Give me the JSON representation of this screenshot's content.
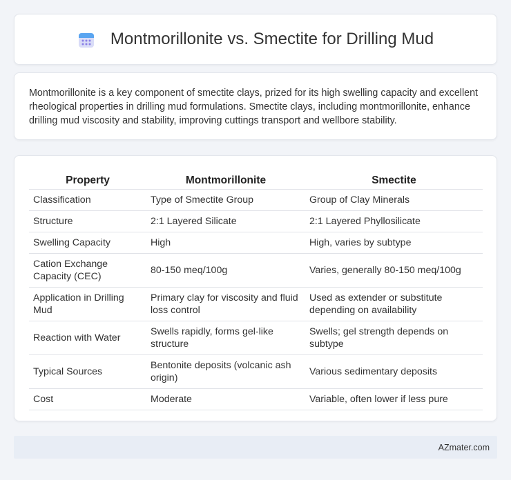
{
  "header": {
    "icon": "calendar-icon",
    "title": "Montmorillonite vs. Smectite for Drilling Mud"
  },
  "description": "Montmorillonite is a key component of smectite clays, prized for its high swelling capacity and excellent rheological properties in drilling mud formulations. Smectite clays, including montmorillonite, enhance drilling mud viscosity and stability, improving cuttings transport and wellbore stability.",
  "table": {
    "headers": [
      "Property",
      "Montmorillonite",
      "Smectite"
    ],
    "rows": [
      [
        "Classification",
        "Type of Smectite Group",
        "Group of Clay Minerals"
      ],
      [
        "Structure",
        "2:1 Layered Silicate",
        "2:1 Layered Phyllosilicate"
      ],
      [
        "Swelling Capacity",
        "High",
        "High, varies by subtype"
      ],
      [
        "Cation Exchange Capacity (CEC)",
        "80-150 meq/100g",
        "Varies, generally 80-150 meq/100g"
      ],
      [
        "Application in Drilling Mud",
        "Primary clay for viscosity and fluid loss control",
        "Used as extender or substitute depending on availability"
      ],
      [
        "Reaction with Water",
        "Swells rapidly, forms gel-like structure",
        "Swells; gel strength depends on subtype"
      ],
      [
        "Typical Sources",
        "Bentonite deposits (volcanic ash origin)",
        "Various sedimentary deposits"
      ],
      [
        "Cost",
        "Moderate",
        "Variable, often lower if less pure"
      ]
    ]
  },
  "footer": {
    "brand": "AZmater.com"
  },
  "colors": {
    "background": "#f2f4f8",
    "card": "#ffffff",
    "footer_bg": "#e8edf5",
    "icon_accent": "#7b6fe0"
  }
}
